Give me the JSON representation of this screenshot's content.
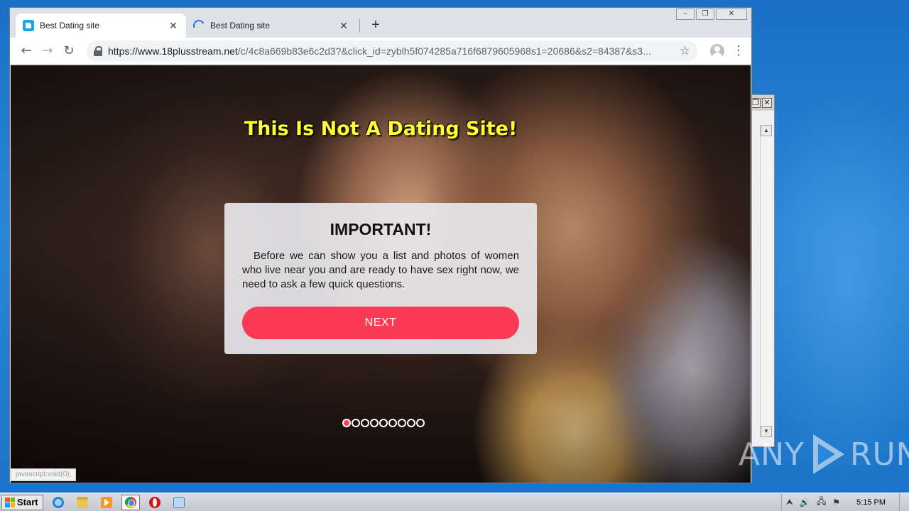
{
  "browser": {
    "tabs": [
      {
        "title": "Best Dating site",
        "active": true,
        "favicon": "site-favicon"
      },
      {
        "title": "Best Dating site",
        "active": false,
        "favicon": "loading-spinner-icon"
      }
    ],
    "tab_close_glyph": "✕",
    "new_tab_glyph": "+",
    "nav": {
      "back": "←",
      "forward": "→",
      "reload": "↻"
    },
    "url_host": "https://www.18plusstream.net",
    "url_path": "/c/4c8a669b83e6c2d3?&click_id=zyblh5f074285a716f6879605968s1=20686&s2=84387&s3...",
    "star_glyph": "☆",
    "menu_glyph": "⋮",
    "window_controls": {
      "minimize": "–",
      "restore": "❐",
      "close": "✕"
    },
    "status_text": "javascript:void(0);"
  },
  "page": {
    "headline": "This Is Not A Dating Site!",
    "modal": {
      "title": "IMPORTANT!",
      "text": "Before we can show you a list and photos of women who live near you and are ready to have sex right now, we need to ask a few quick questions.",
      "button": "NEXT"
    },
    "progress": {
      "steps": 9,
      "current": 1
    }
  },
  "background_window": {
    "restore_glyph": "❐",
    "close_glyph": "✕",
    "scroll_up": "▲",
    "scroll_down": "▼"
  },
  "taskbar": {
    "start_label": "Start",
    "apps": [
      "internet-explorer-icon",
      "file-explorer-icon",
      "media-player-icon",
      "chrome-icon",
      "opera-icon",
      "notepad-icon"
    ],
    "tray": {
      "expand": "⮝",
      "volume": "🔊",
      "network": "🖧",
      "flag": "⚑"
    },
    "clock": "5:15 PM"
  },
  "watermark": {
    "text_left": "ANY",
    "text_right": "RUN"
  },
  "colors": {
    "accent_button": "#fb3a55",
    "headline": "#ffff33",
    "tab_active": "#ffffff",
    "tabstrip": "#dee1e6"
  }
}
